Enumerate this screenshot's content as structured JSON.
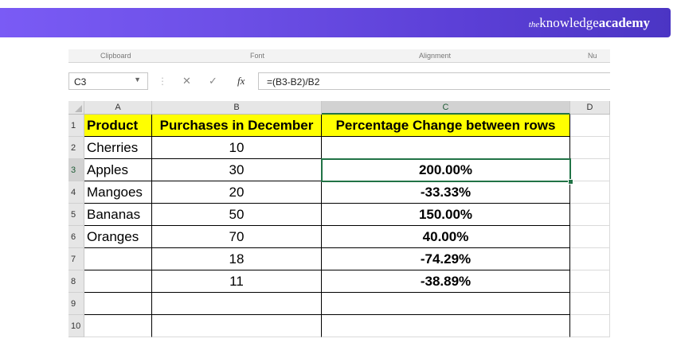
{
  "brand": {
    "the": "the",
    "knowledge": "knowledge",
    "academy": "academy"
  },
  "ribbon_groups": [
    "Clipboard",
    "Font",
    "Alignment",
    "Nu"
  ],
  "formula_bar": {
    "name_box": "C3",
    "fx": "fx",
    "formula": "=(B3-B2)/B2"
  },
  "columns": [
    "A",
    "B",
    "C",
    "D"
  ],
  "rows": [
    "1",
    "2",
    "3",
    "4",
    "5",
    "6",
    "7",
    "8",
    "9",
    "10"
  ],
  "table": {
    "header": [
      "Product",
      "Purchases in December",
      "Percentage Change between rows"
    ],
    "data": [
      [
        "Cherries",
        "10",
        ""
      ],
      [
        "Apples",
        "30",
        "200.00%"
      ],
      [
        "Mangoes",
        "20",
        "-33.33%"
      ],
      [
        "Bananas",
        "50",
        "150.00%"
      ],
      [
        "Oranges",
        "70",
        "40.00%"
      ],
      [
        "",
        "18",
        "-74.29%"
      ],
      [
        "",
        "11",
        "-38.89%"
      ],
      [
        "",
        "",
        ""
      ]
    ]
  },
  "active_cell": "C3",
  "colors": {
    "header_fill": "#ffff00",
    "selection": "#217346",
    "banner": "#5b3fd6"
  }
}
